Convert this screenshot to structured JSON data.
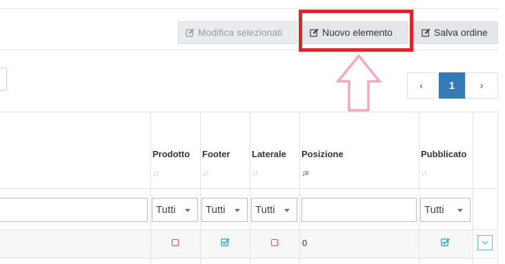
{
  "toolbar": {
    "modifica_label": "Modifica selezionati",
    "nuovo_label": "Nuovo elemento",
    "salva_label": "Salva ordine"
  },
  "pagination": {
    "prev": "‹",
    "current_page": "1",
    "next": "›"
  },
  "table": {
    "columns": [
      {
        "label": "Prodotto",
        "sort_icon": "↓↑"
      },
      {
        "label": "Footer",
        "sort_icon": "↓↑"
      },
      {
        "label": "Laterale",
        "sort_icon": "↓↑"
      },
      {
        "label": "Posizione",
        "sort_icon": "↓≡"
      },
      {
        "label": "Pubblicato",
        "sort_icon": "↓↑"
      }
    ],
    "filters": {
      "prodotto": "Tutti",
      "footer": "Tutti",
      "laterale": "Tutti",
      "posizione": "",
      "pubblicato": "Tutti"
    },
    "rows": [
      {
        "prodotto": false,
        "footer": true,
        "laterale": false,
        "posizione": "0",
        "pubblicato": true
      }
    ]
  },
  "colors": {
    "highlight": "#e0242e",
    "arrow": "#f5a6c4",
    "primary": "#337ab7",
    "checked": "#2aa6c9",
    "unchecked": "#e0474c"
  }
}
